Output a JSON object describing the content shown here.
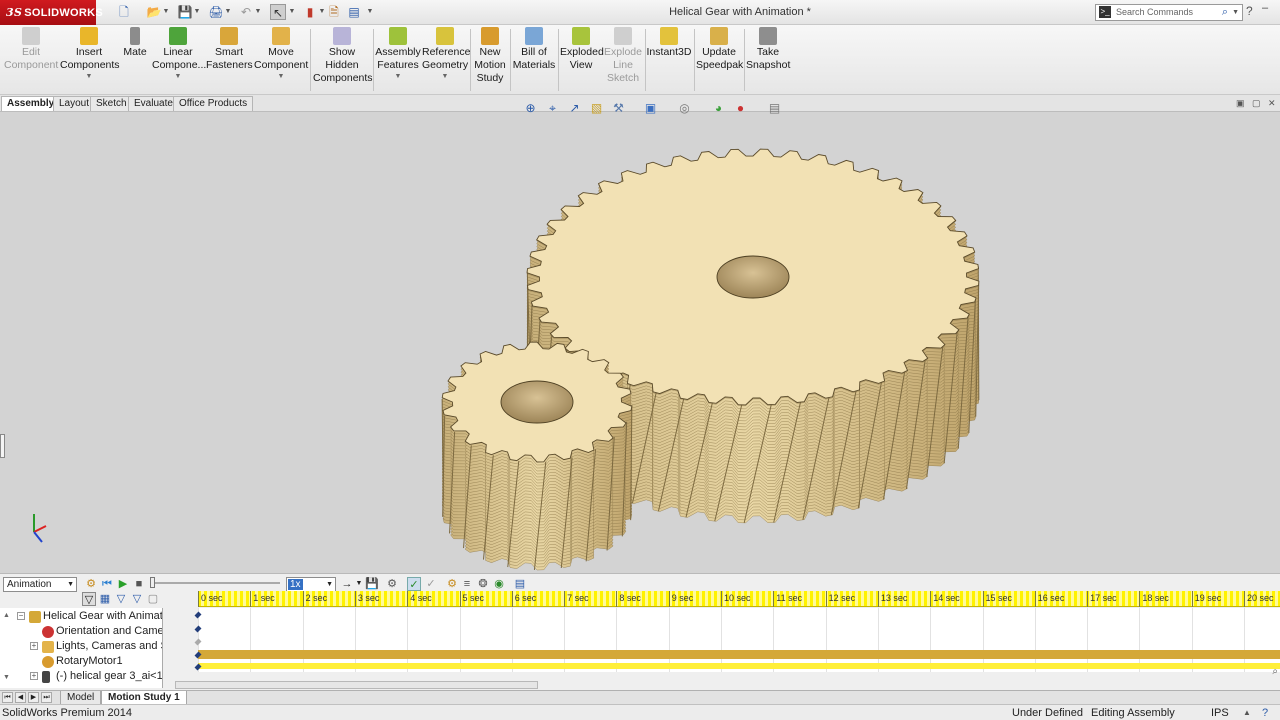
{
  "app": {
    "brand": "SOLIDWORKS",
    "brand_prefix": "3S",
    "title": "Helical Gear with Animation *"
  },
  "search": {
    "placeholder": "Search Commands"
  },
  "ribbon": {
    "buttons": [
      {
        "label": "Edit\nComponent",
        "disabled": true
      },
      {
        "label": "Insert\nComponents",
        "dropdown": true
      },
      {
        "label": "Mate"
      },
      {
        "label": "Linear\nCompone...",
        "dropdown": true
      },
      {
        "label": "Smart\nFasteners"
      },
      {
        "label": "Move\nComponent",
        "dropdown": true
      },
      {
        "label": "Show\nHidden\nComponents"
      },
      {
        "label": "Assembly\nFeatures",
        "dropdown": true
      },
      {
        "label": "Reference\nGeometry",
        "dropdown": true
      },
      {
        "label": "New\nMotion\nStudy"
      },
      {
        "label": "Bill of\nMaterials"
      },
      {
        "label": "Exploded\nView"
      },
      {
        "label": "Explode\nLine\nSketch",
        "disabled": true
      },
      {
        "label": "Instant3D"
      },
      {
        "label": "Update\nSpeedpak"
      },
      {
        "label": "Take\nSnapshot"
      }
    ]
  },
  "tabs": [
    "Assembly",
    "Layout",
    "Sketch",
    "Evaluate",
    "Office Products"
  ],
  "motion": {
    "study_type": "Animation",
    "playback_speed": "1x",
    "timeline_ticks": [
      "0 sec",
      "1 sec",
      "2 sec",
      "3 sec",
      "4 sec",
      "5 sec",
      "6 sec",
      "7 sec",
      "8 sec",
      "9 sec",
      "10 sec",
      "11 sec",
      "12 sec",
      "13 sec",
      "14 sec",
      "15 sec",
      "16 sec",
      "17 sec",
      "18 sec",
      "19 sec",
      "20 sec"
    ],
    "tree": [
      {
        "label": "Helical Gear with Animati",
        "icon": "assembly-icon",
        "expander": "−"
      },
      {
        "label": "Orientation and Camer",
        "icon": "camera-view-icon",
        "expander": ""
      },
      {
        "label": "Lights, Cameras and Sc",
        "icon": "lights-folder-icon",
        "expander": "+"
      },
      {
        "label": "RotaryMotor1",
        "icon": "rotary-motor-icon",
        "expander": ""
      },
      {
        "label": "(-) helical gear 3_ai<1:",
        "icon": "part-icon",
        "expander": "+"
      }
    ]
  },
  "bottom_tabs": [
    "Model",
    "Motion Study 1"
  ],
  "status": {
    "left": "SolidWorks Premium 2014",
    "state": "Under Defined",
    "mode": "Editing Assembly",
    "units": "IPS"
  },
  "colors": {
    "gear_face": "#f2e1b4",
    "gear_side": "#d9c38f",
    "viewport": "#d3d3d3",
    "motor_bar": "#d4a838",
    "ruler": "#fff200"
  }
}
